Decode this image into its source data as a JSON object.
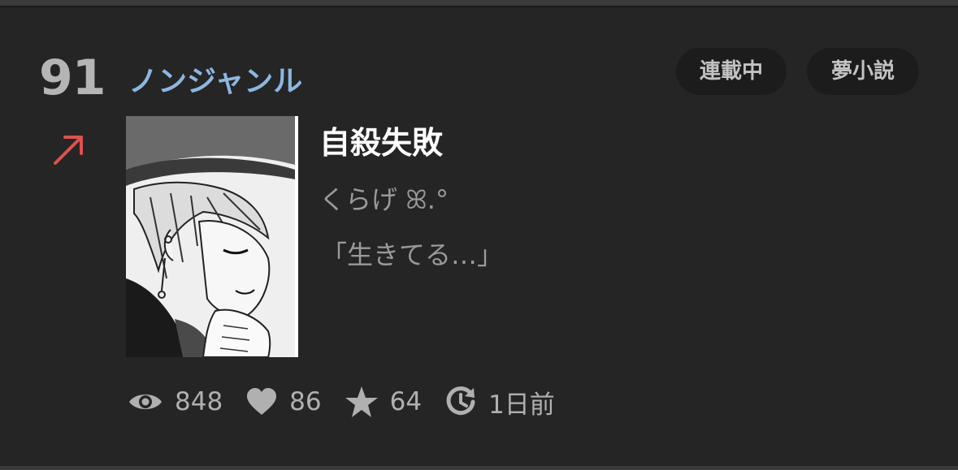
{
  "rank": "91",
  "genre": "ノンジャンル",
  "badges": {
    "status": "連載中",
    "category": "夢小説"
  },
  "trend_icon": "arrow-up-right-icon",
  "cover_icon": "manga-cover-image",
  "work": {
    "title": "自殺失敗",
    "author": "くらげ ꕤ.°",
    "catchphrase": "「生きてる…」"
  },
  "stats": {
    "views": "848",
    "likes": "86",
    "stars": "64",
    "updated": "1日前"
  },
  "colors": {
    "background": "#252525",
    "genre": "#8db6e0",
    "trend_arrow": "#d9534f",
    "badge_bg": "#1c1c1c"
  }
}
